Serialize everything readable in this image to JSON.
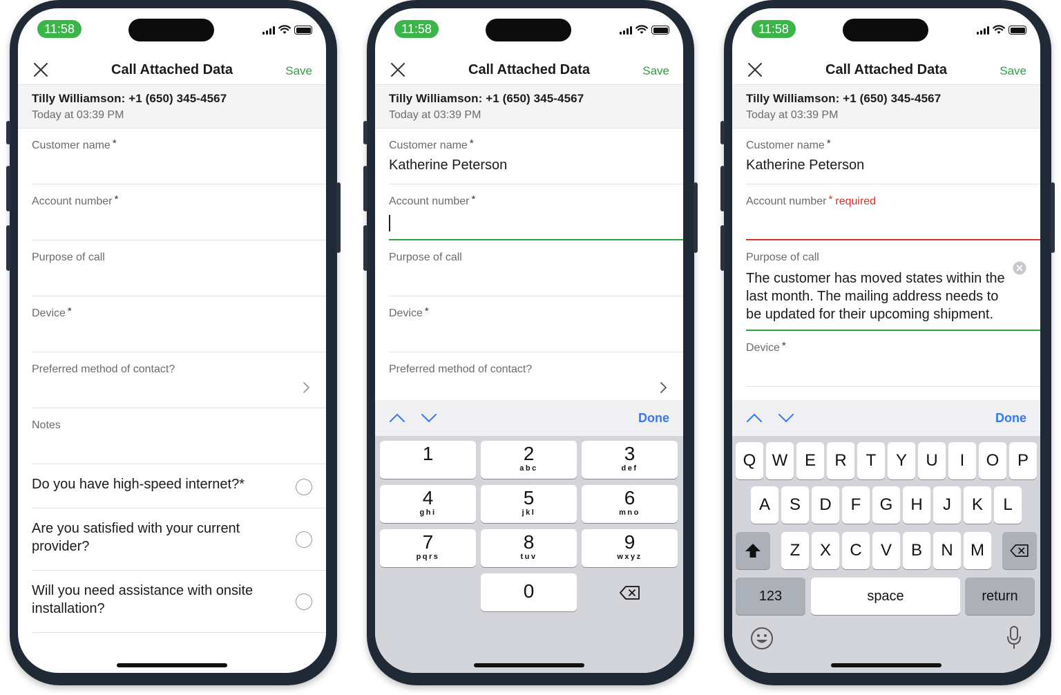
{
  "status": {
    "time": "11:58"
  },
  "nav": {
    "title": "Call Attached Data",
    "save_label": "Save"
  },
  "contact": {
    "who": "Tilly Williamson: +1 (650) 345-4567",
    "when": "Today at 03:39 PM"
  },
  "labels": {
    "customer_name": "Customer name",
    "account_number": "Account number",
    "purpose": "Purpose of call",
    "device": "Device",
    "preferred": "Preferred method of contact?",
    "notes": "Notes",
    "required_star": "*",
    "required_text": "required"
  },
  "questions": [
    {
      "text": "Do you have high-speed internet?",
      "required": "*"
    },
    {
      "text": "Are you satisfied with your current provider?"
    },
    {
      "text": "Will you need assistance with onsite installation?"
    }
  ],
  "values": {
    "customer_name": "Katherine Peterson",
    "purpose": "The customer has moved states within the last month. The mailing address needs to be updated for their upcoming shipment."
  },
  "accessory": {
    "done_label": "Done"
  },
  "numpad": [
    {
      "digit": "1",
      "letters": ""
    },
    {
      "digit": "2",
      "letters": "abc"
    },
    {
      "digit": "3",
      "letters": "def"
    },
    {
      "digit": "4",
      "letters": "ghi"
    },
    {
      "digit": "5",
      "letters": "jkl"
    },
    {
      "digit": "6",
      "letters": "mno"
    },
    {
      "digit": "7",
      "letters": "pqrs"
    },
    {
      "digit": "8",
      "letters": "tuv"
    },
    {
      "digit": "9",
      "letters": "wxyz"
    },
    {
      "digit": "0",
      "letters": ""
    }
  ],
  "keyboard": {
    "row1": [
      "Q",
      "W",
      "E",
      "R",
      "T",
      "Y",
      "U",
      "I",
      "O",
      "P"
    ],
    "row2": [
      "A",
      "S",
      "D",
      "F",
      "G",
      "H",
      "J",
      "K",
      "L"
    ],
    "row3": [
      "Z",
      "X",
      "C",
      "V",
      "B",
      "N",
      "M"
    ],
    "numbers_label": "123",
    "space_label": "space",
    "return_label": "return"
  },
  "colors": {
    "accent_green": "#2ea043",
    "error_red": "#d93025",
    "link_blue": "#3478f6",
    "time_pill": "#3bb54a",
    "frame": "#1f2a36"
  }
}
